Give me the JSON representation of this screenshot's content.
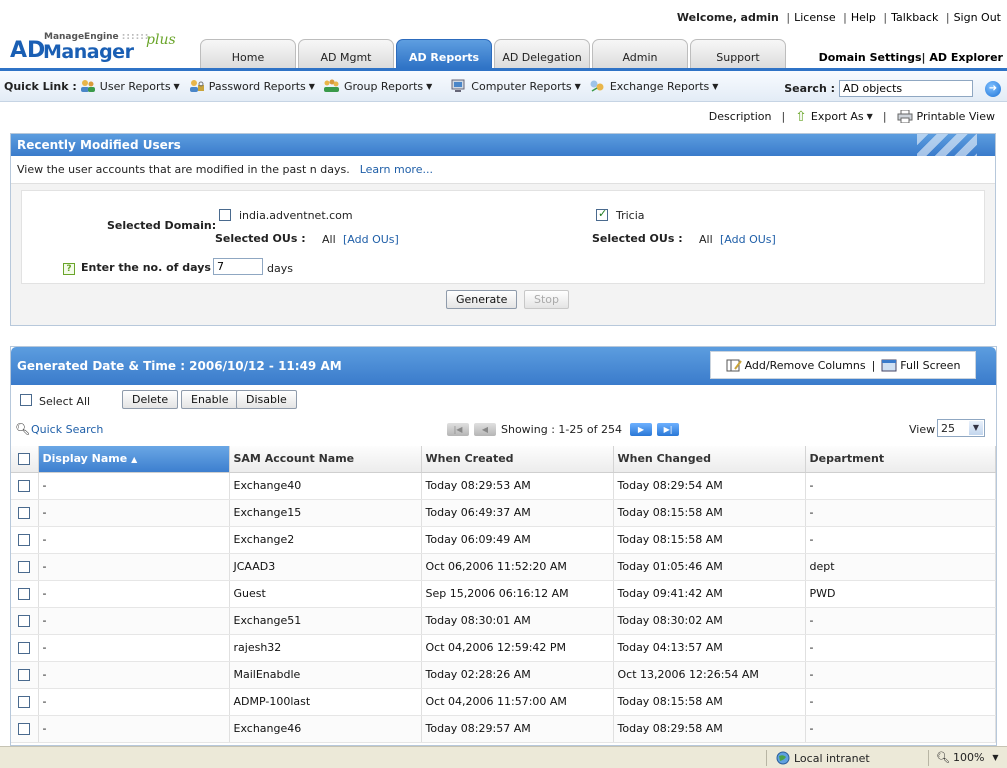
{
  "brand": {
    "top": "ManageEngine",
    "dots": "::::::",
    "ad": "AD",
    "main": "Manager",
    "plus": "plus"
  },
  "top_links": {
    "welcome": "Welcome,",
    "user": "admin",
    "license": "License",
    "help": "Help",
    "talkback": "Talkback",
    "sign_out": "Sign Out"
  },
  "right_links": {
    "domain_settings": "Domain Settings",
    "ad_explorer": "AD Explorer"
  },
  "tabs": [
    {
      "label": "Home"
    },
    {
      "label": "AD Mgmt"
    },
    {
      "label": "AD Reports",
      "active": true
    },
    {
      "label": "AD Delegation"
    },
    {
      "label": "Admin"
    },
    {
      "label": "Support"
    }
  ],
  "quick_link": {
    "label": "Quick Link :",
    "items": [
      {
        "label": "User Reports",
        "icon": "user-reports-icon"
      },
      {
        "label": "Password Reports",
        "icon": "password-reports-icon"
      },
      {
        "label": "Group Reports",
        "icon": "group-reports-icon"
      },
      {
        "label": "Computer Reports",
        "icon": "computer-reports-icon"
      },
      {
        "label": "Exchange Reports",
        "icon": "exchange-reports-icon"
      }
    ]
  },
  "search": {
    "label": "Search :",
    "value": "AD objects"
  },
  "actions": {
    "description": "Description",
    "export_as": "Export As",
    "printable_view": "Printable View"
  },
  "panel1": {
    "title": "Recently Modified Users",
    "description": "View the user accounts that are modified in the past n days.",
    "learn_more": "Learn more...",
    "selected_domain_label": "Selected Domain:",
    "domains": [
      {
        "name": "india.adventnet.com",
        "checked": false,
        "ous_label": "Selected OUs :",
        "ous_value": "All",
        "add_ous": "[Add OUs]"
      },
      {
        "name": "Tricia",
        "checked": true,
        "ous_label": "Selected OUs :",
        "ous_value": "All",
        "add_ous": "[Add OUs]"
      }
    ],
    "days_label": "Enter the no. of days :",
    "days_value": "7",
    "days_unit": "days",
    "generate": "Generate",
    "stop": "Stop"
  },
  "panel2": {
    "title": "Generated Date & Time : 2006/10/12 - 11:49 AM",
    "add_remove_columns": "Add/Remove Columns",
    "full_screen": "Full Screen",
    "select_all": "Select All",
    "buttons": {
      "delete": "Delete",
      "enable": "Enable",
      "disable": "Disable"
    },
    "quick_search": "Quick Search",
    "showing": "Showing : 1-25 of 254",
    "view_label": "View",
    "view_value": "25",
    "columns": [
      "Display Name",
      "SAM Account Name",
      "When Created",
      "When Changed",
      "Department"
    ],
    "rows": [
      [
        "-",
        "Exchange40",
        "Today 08:29:53 AM",
        "Today 08:29:54 AM",
        "-"
      ],
      [
        "-",
        "Exchange15",
        "Today 06:49:37 AM",
        "Today 08:15:58 AM",
        "-"
      ],
      [
        "-",
        "Exchange2",
        "Today 06:09:49 AM",
        "Today 08:15:58 AM",
        "-"
      ],
      [
        "-",
        "JCAAD3",
        "Oct 06,2006 11:52:20 AM",
        "Today 01:05:46 AM",
        "dept"
      ],
      [
        "-",
        "Guest",
        "Sep 15,2006 06:16:12 AM",
        "Today 09:41:42 AM",
        "PWD"
      ],
      [
        "-",
        "Exchange51",
        "Today 08:30:01 AM",
        "Today 08:30:02 AM",
        "-"
      ],
      [
        "-",
        "rajesh32",
        "Oct 04,2006 12:59:42 PM",
        "Today 04:13:57 AM",
        "-"
      ],
      [
        "-",
        "MailEnabdle",
        "Today 02:28:26 AM",
        "Oct 13,2006 12:26:54 AM",
        "-"
      ],
      [
        "-",
        "ADMP-100last",
        "Oct 04,2006 11:57:00 AM",
        "Today 08:15:58 AM",
        "-"
      ],
      [
        "-",
        "Exchange46",
        "Today 08:29:57 AM",
        "Today 08:29:58 AM",
        "-"
      ]
    ]
  },
  "statusbar": {
    "zone": "Local intranet",
    "zoom": "100%"
  }
}
